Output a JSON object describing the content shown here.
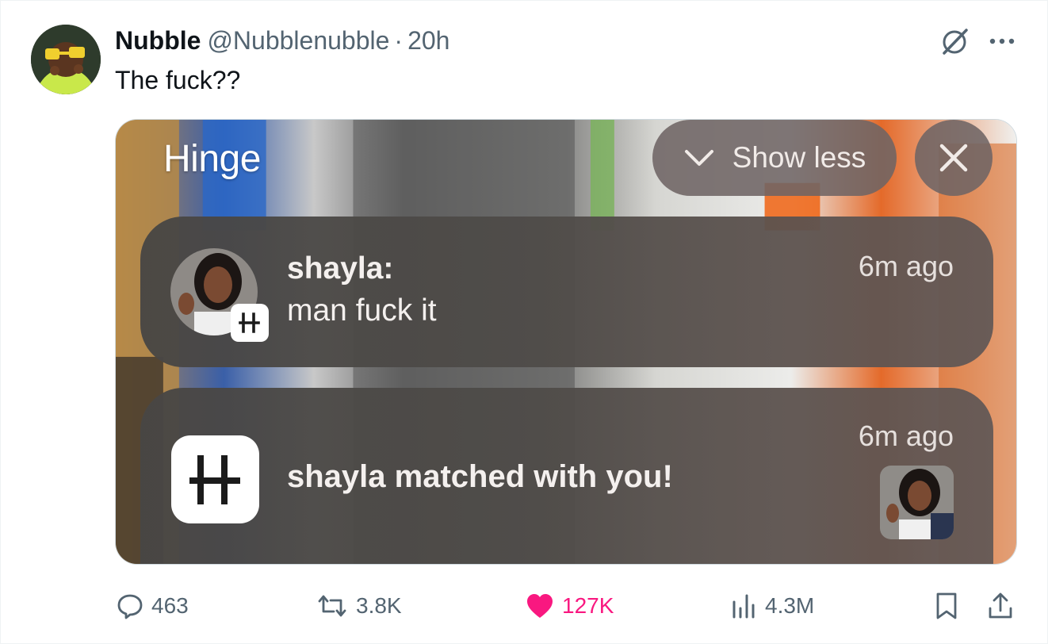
{
  "tweet": {
    "author_name": "Nubble",
    "author_handle": "@Nubblenubble",
    "separator": "·",
    "time": "20h",
    "text": "The fuck??"
  },
  "media": {
    "app_title": "Hinge",
    "show_less_label": "Show less",
    "notifications": [
      {
        "sender": "shayla:",
        "message": "man fuck it",
        "time": "6m ago"
      },
      {
        "text": "shayla matched with you!",
        "time": "6m ago"
      }
    ]
  },
  "actions": {
    "replies": "463",
    "reposts": "3.8K",
    "likes": "127K",
    "views": "4.3M"
  },
  "icons": {
    "grok": "grok-icon",
    "more": "more-icon",
    "reply": "reply-icon",
    "repost": "repost-icon",
    "like": "heart-icon",
    "views": "views-icon",
    "bookmark": "bookmark-icon",
    "share": "share-icon"
  },
  "colors": {
    "like_active": "#f91880",
    "secondary_text": "#536471"
  }
}
